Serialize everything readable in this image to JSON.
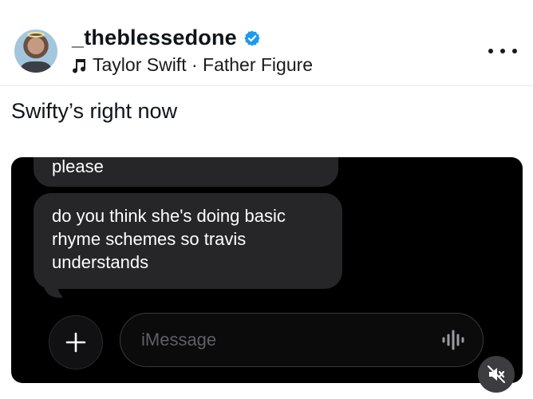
{
  "post": {
    "username": "_theblessedone",
    "music": "Taylor Swift · Father Figure",
    "caption": "Swifty’s right now"
  },
  "icons": {
    "verified": "verified-badge-icon",
    "music": "music-note-icon",
    "more": "more-options-icon",
    "plus": "plus-icon",
    "audio": "audio-waveform-icon",
    "mute": "speaker-muted-icon"
  },
  "media": {
    "previous_message": "please",
    "message": "do you think she's doing basic rhyme schemes so travis understands",
    "input_placeholder": "iMessage"
  },
  "colors": {
    "verified": "#1d9bf0",
    "bubble": "#262628",
    "background": "#000000"
  }
}
